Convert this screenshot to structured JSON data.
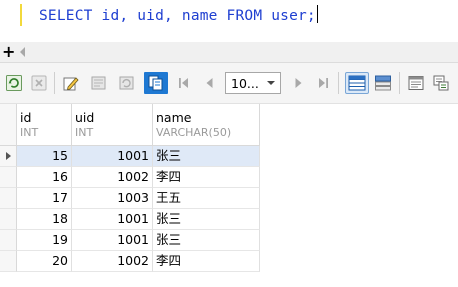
{
  "editor": {
    "sql_select": "SELECT",
    "sql_cols": " id, uid, name ",
    "sql_from": "FROM",
    "sql_table": " user;"
  },
  "strip": {
    "split_glyph": "+"
  },
  "toolbar": {
    "rows_limit": "10..."
  },
  "grid": {
    "columns": [
      {
        "name": "id",
        "type": "INT"
      },
      {
        "name": "uid",
        "type": "INT"
      },
      {
        "name": "name",
        "type": "VARCHAR(50)"
      }
    ],
    "rows": [
      {
        "id": "15",
        "uid": "1001",
        "name": "张三"
      },
      {
        "id": "16",
        "uid": "1002",
        "name": "李四"
      },
      {
        "id": "17",
        "uid": "1003",
        "name": "王五"
      },
      {
        "id": "18",
        "uid": "1001",
        "name": "张三"
      },
      {
        "id": "19",
        "uid": "1001",
        "name": "张三"
      },
      {
        "id": "20",
        "uid": "1002",
        "name": "李四"
      }
    ]
  }
}
